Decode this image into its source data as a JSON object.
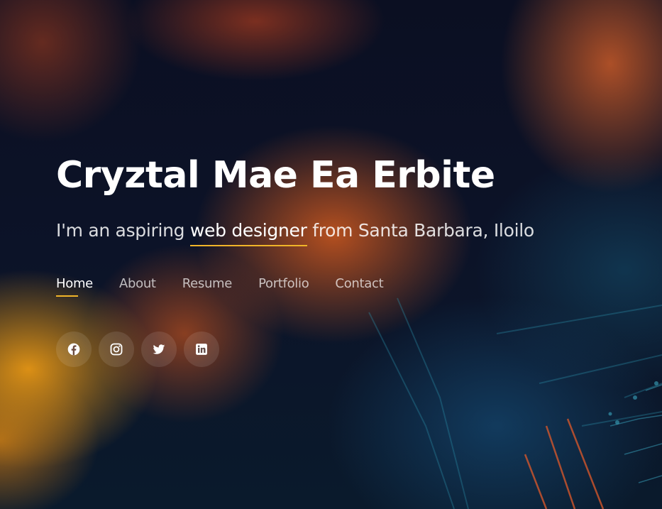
{
  "hero": {
    "name": "Cryztal Mae Ea Erbite",
    "subtitle_prefix": "I'm an aspiring ",
    "subtitle_typed": "web designer",
    "subtitle_suffix": " from Santa Barbara, Iloilo"
  },
  "nav": {
    "items": [
      {
        "label": "Home",
        "active": true
      },
      {
        "label": "About",
        "active": false
      },
      {
        "label": "Resume",
        "active": false
      },
      {
        "label": "Portfolio",
        "active": false
      },
      {
        "label": "Contact",
        "active": false
      }
    ]
  },
  "social": {
    "icons": [
      "facebook-icon",
      "instagram-icon",
      "twitter-icon",
      "linkedin-icon"
    ]
  },
  "colors": {
    "accent": "#f0b429",
    "text": "#ffffff"
  }
}
